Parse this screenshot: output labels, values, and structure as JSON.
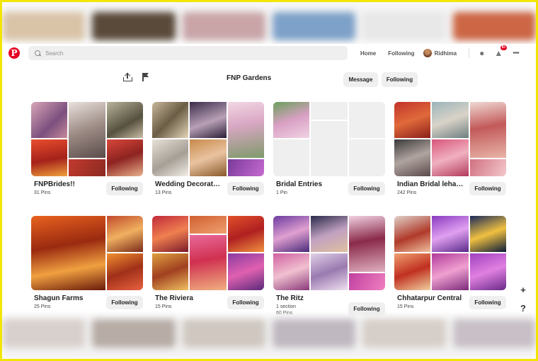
{
  "header": {
    "logo_glyph": "P",
    "search_placeholder": "Search",
    "nav": [
      "Home",
      "Following"
    ],
    "profile_name": "Ridhima",
    "notification_badge": "9+"
  },
  "board_page": {
    "title": "FNP Gardens",
    "message_label": "Message",
    "following_label": "Following"
  },
  "boards": [
    {
      "name": "FNPBrides!!",
      "meta": [
        "31 Pins"
      ],
      "follow_label": "Following"
    },
    {
      "name": "Wedding Decorat…",
      "meta": [
        "13 Pins"
      ],
      "follow_label": "Following"
    },
    {
      "name": "Bridal Entries",
      "meta": [
        "1 Pin"
      ],
      "follow_label": "Following"
    },
    {
      "name": "Indian Bridal leha…",
      "meta": [
        "242 Pins"
      ],
      "follow_label": "Following"
    },
    {
      "name": "Shagun Farms",
      "meta": [
        "25 Pins"
      ],
      "follow_label": "Following"
    },
    {
      "name": "The Riviera",
      "meta": [
        "15 Pins"
      ],
      "follow_label": "Following"
    },
    {
      "name": "The Ritz",
      "meta": [
        "1 section",
        "60 Pins"
      ],
      "follow_label": "Following"
    },
    {
      "name": "Chhatarpur Central",
      "meta": [
        "15 Pins"
      ],
      "follow_label": "Following"
    }
  ],
  "side_buttons": {
    "add": "+",
    "help": "?"
  },
  "icons": [
    "pinterest-logo",
    "search-icon",
    "chat-icon",
    "bell-icon",
    "more-icon",
    "upload-icon",
    "flag-icon"
  ],
  "colors": {
    "brand": "#e60023",
    "frame": "#f2e600",
    "button_bg": "#efefef"
  }
}
